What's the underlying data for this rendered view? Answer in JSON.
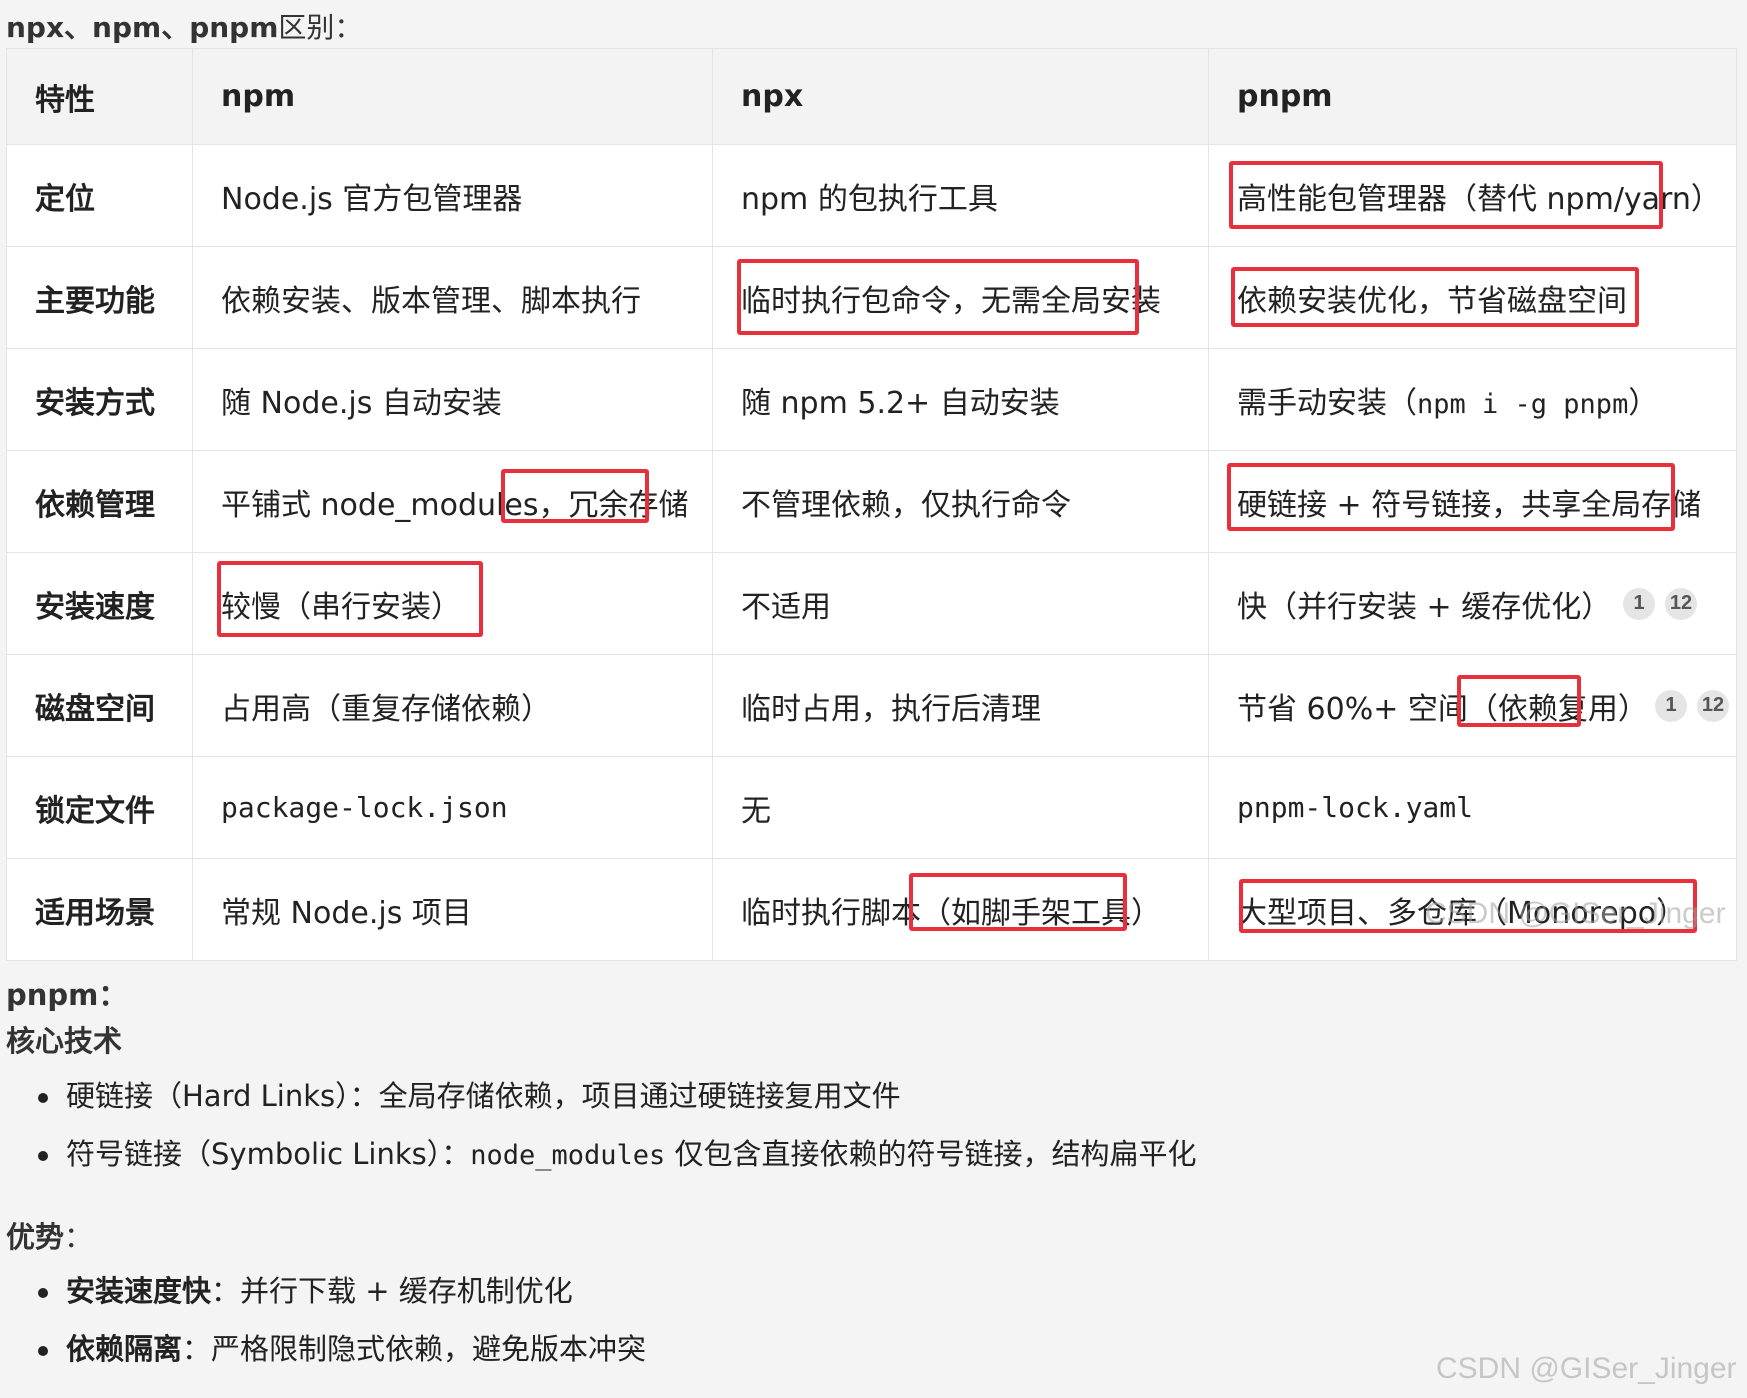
{
  "intro": {
    "bold": "npx、npm、pnpm",
    "plain": "区别："
  },
  "table": {
    "headers": [
      "特性",
      "npm",
      "npx",
      "pnpm"
    ],
    "rows": [
      {
        "feature": "定位",
        "npm": "Node.js 官方包管理器",
        "npx": "npm 的包执行工具",
        "pnpm": "高性能包管理器（替代 npm/yarn）"
      },
      {
        "feature": "主要功能",
        "npm": "依赖安装、版本管理、脚本执行",
        "npx": "临时执行包命令，无需全局安装",
        "pnpm": "依赖安装优化，节省磁盘空间"
      },
      {
        "feature": "安装方式",
        "npm": "随 Node.js 自动安装",
        "npx": "随 npm 5.2+ 自动安装",
        "pnpm_pre": "需手动安装（",
        "pnpm_code": "npm i -g pnpm",
        "pnpm_post": "）"
      },
      {
        "feature": "依赖管理",
        "npm": "平铺式 node_modules，冗余存储",
        "npx": "不管理依赖，仅执行命令",
        "pnpm": "硬链接 + 符号链接，共享全局存储"
      },
      {
        "feature": "安装速度",
        "npm": "较慢（串行安装）",
        "npx": "不适用",
        "pnpm": "快（并行安装 + 缓存优化）",
        "badges": [
          "1",
          "12"
        ]
      },
      {
        "feature": "磁盘空间",
        "npm": "占用高（重复存储依赖）",
        "npx": "临时占用，执行后清理",
        "pnpm": "节省 60%+ 空间（依赖复用）",
        "badges": [
          "1",
          "12"
        ]
      },
      {
        "feature": "锁定文件",
        "npm": "package-lock.json",
        "npx": "无",
        "pnpm": "pnpm-lock.yaml"
      },
      {
        "feature": "适用场景",
        "npm": "常规 Node.js 项目",
        "npx": "临时执行脚本（如脚手架工具）",
        "pnpm": "大型项目、多仓库（Monorepo）"
      }
    ]
  },
  "pnpm_section": {
    "title": "pnpm：",
    "core_title": "核心技术",
    "core_items": [
      {
        "text": "硬链接（Hard Links）：全局存储依赖，项目通过硬链接复用文件"
      },
      {
        "pre": "符号链接（Symbolic Links）：",
        "code": "node_modules",
        "post": " 仅包含直接依赖的符号链接，结构扁平化"
      }
    ],
    "adv_title": "优势",
    "adv_colon": "：",
    "adv_items": [
      {
        "strong": "安装速度快",
        "rest": "：并行下载 + 缓存机制优化"
      },
      {
        "strong": "依赖隔离",
        "rest": "：严格限制隐式依赖，避免版本冲突"
      }
    ]
  },
  "watermarks": {
    "table": "CSDN @GISer_Jinger",
    "page": "CSDN @GISer_Jinger"
  },
  "colors": {
    "highlight_box": "#e8303c",
    "header_bg": "#f3f3f4",
    "page_bg": "#f4f4f5"
  }
}
